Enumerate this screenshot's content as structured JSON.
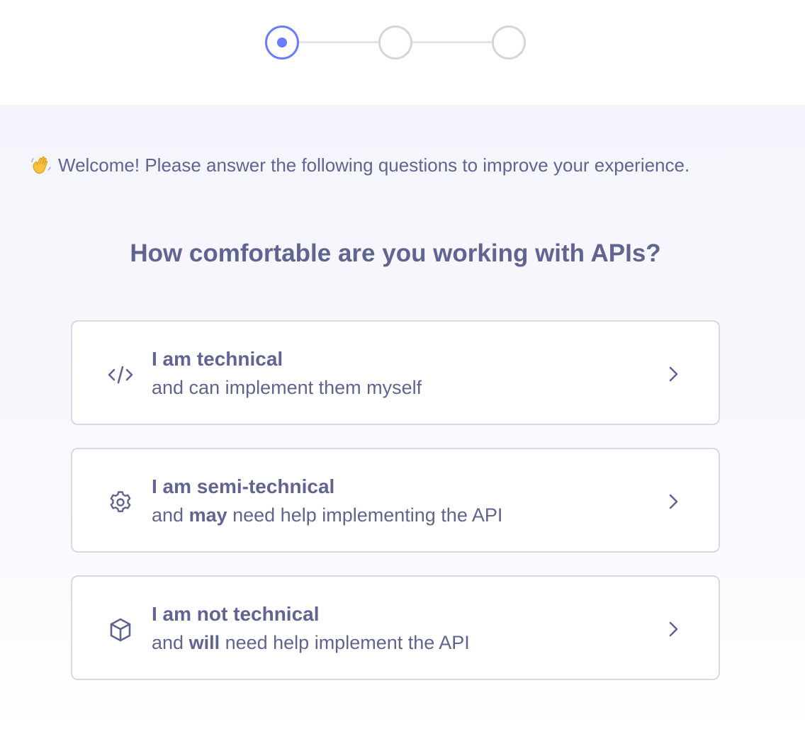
{
  "stepper": {
    "total_steps": 3,
    "current_step": 1
  },
  "welcome": {
    "emoji": "👋",
    "text": "Welcome! Please answer the following questions to improve your experience."
  },
  "question": "How comfortable are you working with APIs?",
  "options": [
    {
      "icon": "code-icon",
      "title": "I am technical",
      "subtitle_before": "and can implement them myself",
      "subtitle_bold": "",
      "subtitle_after": ""
    },
    {
      "icon": "gear-icon",
      "title": "I am semi-technical",
      "subtitle_before": "and ",
      "subtitle_bold": "may",
      "subtitle_after": " need help implementing the API"
    },
    {
      "icon": "cube-icon",
      "title": "I am not technical",
      "subtitle_before": "and ",
      "subtitle_bold": "will",
      "subtitle_after": " need help implement the API"
    }
  ],
  "colors": {
    "accent": "#6b7cff",
    "text": "#5f6590",
    "border": "#d8d9e1",
    "background": "#f4f5fc"
  }
}
